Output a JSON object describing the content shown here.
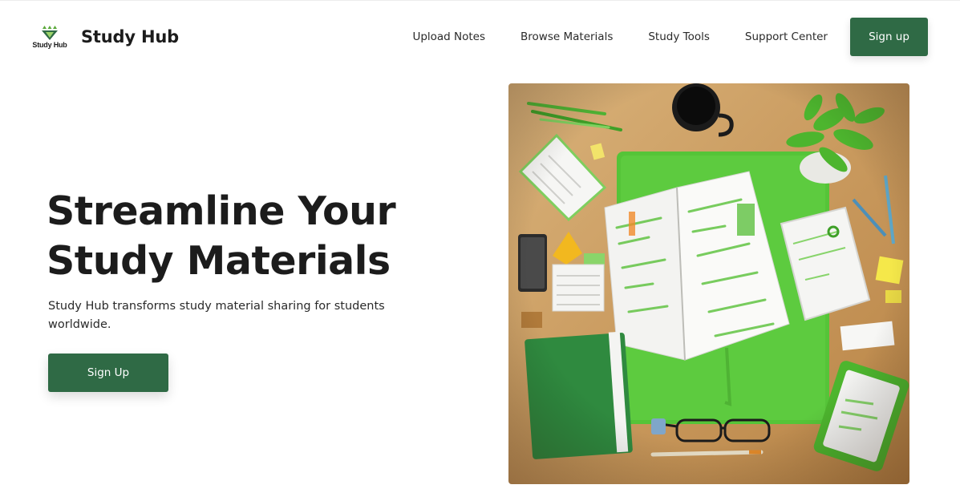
{
  "header": {
    "logo_small_text": "Study Hub",
    "brand": "Study Hub",
    "nav": [
      "Upload Notes",
      "Browse Materials",
      "Study Tools",
      "Support Center"
    ],
    "signup_label": "Sign up"
  },
  "hero": {
    "title_line1": "Streamline Your",
    "title_line2": "Study Materials",
    "subtitle": "Study Hub transforms study material sharing for students worldwide.",
    "cta_label": "Sign Up"
  },
  "colors": {
    "primary": "#2f6a45",
    "accent_green": "#4fbf3a",
    "text": "#1c1c1c"
  },
  "icons": {
    "logo": "stacked-triangles-logo-icon"
  }
}
